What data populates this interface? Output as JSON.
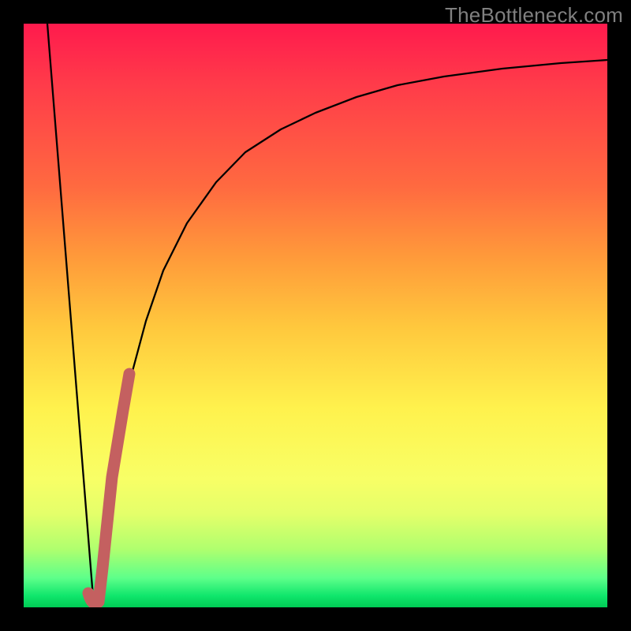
{
  "watermark": "TheBottleneck.com",
  "chart_data": {
    "type": "line",
    "title": "",
    "xlabel": "",
    "ylabel": "",
    "xlim": [
      0,
      100
    ],
    "ylim": [
      0,
      100
    ],
    "grid": false,
    "legend": false,
    "series": [
      {
        "name": "left-descending-line",
        "color": "#000000",
        "x": [
          4,
          12
        ],
        "values": [
          100,
          0
        ]
      },
      {
        "name": "rising-curve",
        "color": "#000000",
        "x": [
          12,
          15,
          18,
          21,
          24,
          28,
          33,
          38,
          44,
          50,
          57,
          64,
          72,
          82,
          92,
          100
        ],
        "values": [
          0,
          22,
          38,
          49,
          58,
          66,
          73,
          78,
          82,
          85,
          87.5,
          89.5,
          91,
          92.3,
          93.2,
          93.8
        ]
      },
      {
        "name": "highlight-segment",
        "color": "#c46060",
        "x": [
          11,
          12,
          13,
          15,
          17,
          18
        ],
        "values": [
          2,
          0,
          7,
          22,
          34,
          40
        ]
      }
    ],
    "background_gradient": {
      "top": "#ff1a4d",
      "bottom": "#00cc55"
    }
  }
}
